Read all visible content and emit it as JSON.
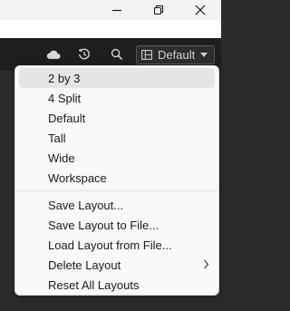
{
  "window": {
    "controls": [
      "minimize-icon",
      "restore-icon",
      "close-icon"
    ]
  },
  "toolbar": {
    "icons": [
      "cloud-icon",
      "history-icon",
      "search-icon"
    ],
    "layout_button": {
      "icon": "layout-grid-icon",
      "label": "Default",
      "caret": "caret-down-icon"
    }
  },
  "menu": {
    "group1": [
      "2 by 3",
      "4 Split",
      "Default",
      "Tall",
      "Wide",
      "Workspace"
    ],
    "group2": [
      "Save Layout...",
      "Save Layout to File...",
      "Load Layout from File...",
      "Delete Layout",
      "Reset All Layouts"
    ],
    "submenu_icon": "chevron-right-icon"
  }
}
